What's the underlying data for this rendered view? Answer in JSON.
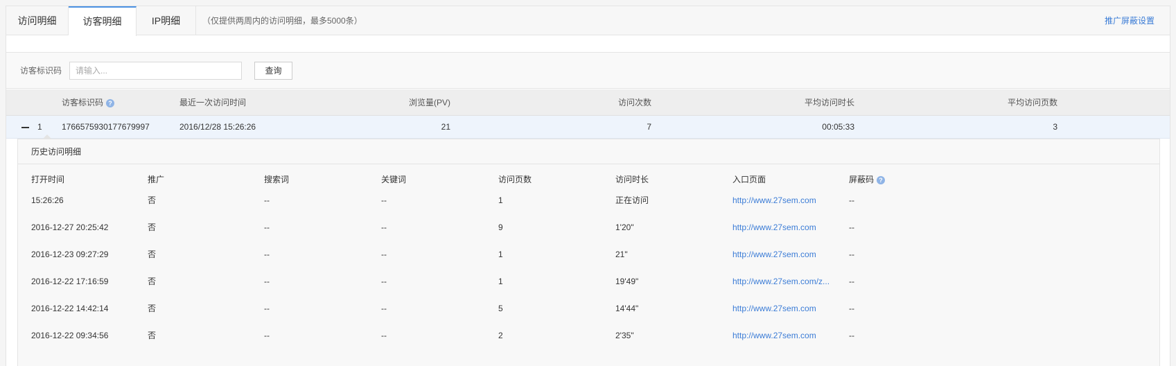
{
  "tabs": [
    {
      "label": "访问明细",
      "active": false
    },
    {
      "label": "访客明细",
      "active": true
    },
    {
      "label": "IP明细",
      "active": false
    }
  ],
  "tab_note": "（仅提供两周内的访问明细，最多5000条）",
  "shield_settings": "推广屏蔽设置",
  "search": {
    "label": "访客标识码",
    "placeholder": "请输入...",
    "button": "查询"
  },
  "table": {
    "headers": {
      "visitor_id": "访客标识码",
      "last_visit": "最近一次访问时间",
      "pv": "浏览量(PV)",
      "visits": "访问次数",
      "avg_duration": "平均访问时长",
      "avg_pages": "平均访问页数"
    },
    "row": {
      "index": "1",
      "visitor_id": "1766575930177679997",
      "last_visit": "2016/12/28 15:26:26",
      "pv": "21",
      "visits": "7",
      "avg_duration": "00:05:33",
      "avg_pages": "3"
    }
  },
  "detail": {
    "title": "历史访问明细",
    "headers": {
      "open_time": "打开时间",
      "promo": "推广",
      "search_word": "搜索词",
      "keyword": "关键词",
      "pages": "访问页数",
      "duration": "访问时长",
      "entry": "入口页面",
      "shield": "屏蔽码"
    },
    "rows": [
      {
        "open_time": "15:26:26",
        "promo": "否",
        "search_word": "--",
        "keyword": "--",
        "pages": "1",
        "duration": "正在访问",
        "entry": "http://www.27sem.com",
        "shield": "--"
      },
      {
        "open_time": "2016-12-27 20:25:42",
        "promo": "否",
        "search_word": "--",
        "keyword": "--",
        "pages": "9",
        "duration": "1'20\"",
        "entry": "http://www.27sem.com",
        "shield": "--"
      },
      {
        "open_time": "2016-12-23 09:27:29",
        "promo": "否",
        "search_word": "--",
        "keyword": "--",
        "pages": "1",
        "duration": "21\"",
        "entry": "http://www.27sem.com",
        "shield": "--"
      },
      {
        "open_time": "2016-12-22 17:16:59",
        "promo": "否",
        "search_word": "--",
        "keyword": "--",
        "pages": "1",
        "duration": "19'49\"",
        "entry": "http://www.27sem.com/z...",
        "shield": "--"
      },
      {
        "open_time": "2016-12-22 14:42:14",
        "promo": "否",
        "search_word": "--",
        "keyword": "--",
        "pages": "5",
        "duration": "14'44\"",
        "entry": "http://www.27sem.com",
        "shield": "--"
      },
      {
        "open_time": "2016-12-22 09:34:56",
        "promo": "否",
        "search_word": "--",
        "keyword": "--",
        "pages": "2",
        "duration": "2'35\"",
        "entry": "http://www.27sem.com",
        "shield": "--"
      }
    ]
  },
  "icons": {
    "help": "help-icon",
    "collapse": "minus-icon"
  },
  "colors": {
    "accent": "#4a90e2",
    "link": "#3b7cd6",
    "row_highlight": "#eef4fc"
  }
}
